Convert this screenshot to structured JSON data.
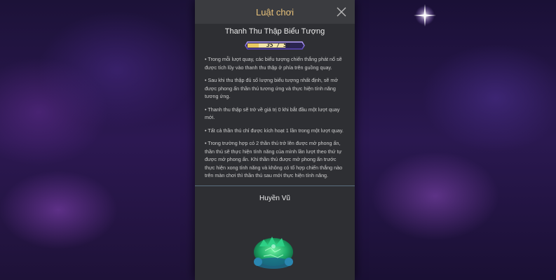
{
  "dialog": {
    "title": "Luật chơi",
    "section_title": "Thanh Thu Thập Biểu Tượng",
    "progress": {
      "current": 35,
      "max": 50,
      "label": "35 / 50"
    },
    "rules": [
      "• Trong mỗi lượt quay, các biểu tượng chiến thắng phát nổ sẽ được tích lũy vào thanh thu thập ở phía trên guồng quay.",
      "• Sau khi thu thập đủ số lượng biểu tượng nhất định, sẽ mở được phong ấn thần thú tương ứng và thực hiện tính năng tương ứng.",
      "• Thanh thu thập sẽ trở về giá trị 0 khi bắt đầu một lượt quay mới.",
      "• Tất cả thần thú chỉ được kích hoạt 1 lần trong một lượt quay.",
      "• Trong trường hợp có 2 thần thú trở lên được mở phong ấn, thần thú sẽ thực hiện tính năng của mình lần lượt theo thứ tự được mở phong ấn. Khi thần thú được mở phong ấn trước thực hiện xong tính năng và không có tổ hợp chiến thắng nào trên màn chơi thì thần thú sau mới thực hiện tính năng."
    ],
    "pet_name": "Huyền Vũ"
  },
  "icons": {
    "close": "close-icon",
    "pet": "huyen-vu-turtle-image",
    "star": "sparkle-star"
  },
  "colors": {
    "title_gold": "#e8c27a",
    "panel": "#2e2f33",
    "bar_fill": "#f2e4a8"
  }
}
